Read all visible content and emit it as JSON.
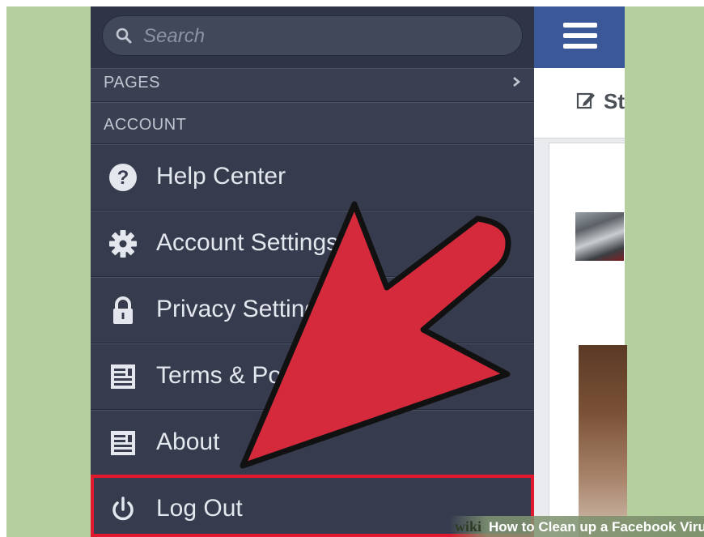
{
  "search": {
    "placeholder": "Search",
    "value": ""
  },
  "sections": {
    "pages_label": "PAGES",
    "account_label": "ACCOUNT"
  },
  "menu": [
    {
      "label": "Help Center",
      "icon": "help-icon"
    },
    {
      "label": "Account Settings",
      "icon": "gear-icon"
    },
    {
      "label": "Privacy Settings",
      "icon": "lock-icon"
    },
    {
      "label": "Terms & Policies",
      "icon": "document-icon"
    },
    {
      "label": "About",
      "icon": "document-icon"
    },
    {
      "label": "Log Out",
      "icon": "power-icon"
    }
  ],
  "content": {
    "status_label": "St"
  },
  "watermark": {
    "brand": "wiki",
    "title": "How to Clean up a Facebook Viru"
  },
  "colors": {
    "sidebar": "#363c4e",
    "topbar": "#3b5998",
    "arrow": "#d42a3c",
    "highlight": "#e0192f",
    "background": "#b6cf9f"
  }
}
